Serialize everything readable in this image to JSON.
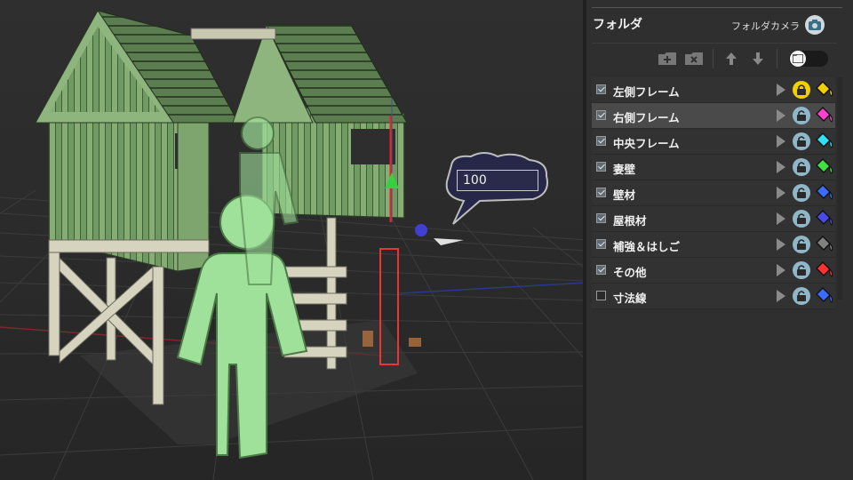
{
  "viewport": {
    "length_input_value": "100"
  },
  "panel": {
    "title": "フォルダ",
    "folder_camera_label": "フォルダカメラ",
    "layers": [
      {
        "name": "左側フレーム",
        "checked": true,
        "locked": true,
        "color": "#f2d000",
        "selected": false
      },
      {
        "name": "右側フレーム",
        "checked": true,
        "locked": false,
        "color": "#ff40d0",
        "selected": true
      },
      {
        "name": "中央フレーム",
        "checked": true,
        "locked": false,
        "color": "#30e0f0",
        "selected": false
      },
      {
        "name": "妻壁",
        "checked": true,
        "locked": false,
        "color": "#40e040",
        "selected": false
      },
      {
        "name": "壁材",
        "checked": true,
        "locked": false,
        "color": "#3a6cff",
        "selected": false
      },
      {
        "name": "屋根材",
        "checked": true,
        "locked": false,
        "color": "#4a4ae8",
        "selected": false
      },
      {
        "name": "補強＆はしご",
        "checked": true,
        "locked": false,
        "color": "#808080",
        "selected": false
      },
      {
        "name": "その他",
        "checked": true,
        "locked": false,
        "color": "#ff3030",
        "selected": false
      },
      {
        "name": "寸法線",
        "checked": false,
        "locked": false,
        "color": "#3a6cff",
        "selected": false
      }
    ],
    "icons": {
      "camera": "camera-icon",
      "new_folder": "folder-add-icon",
      "delete_folder": "folder-delete-icon",
      "move_up": "arrow-up-icon",
      "move_down": "arrow-down-icon",
      "toggle": "folder-toggle-icon"
    }
  }
}
